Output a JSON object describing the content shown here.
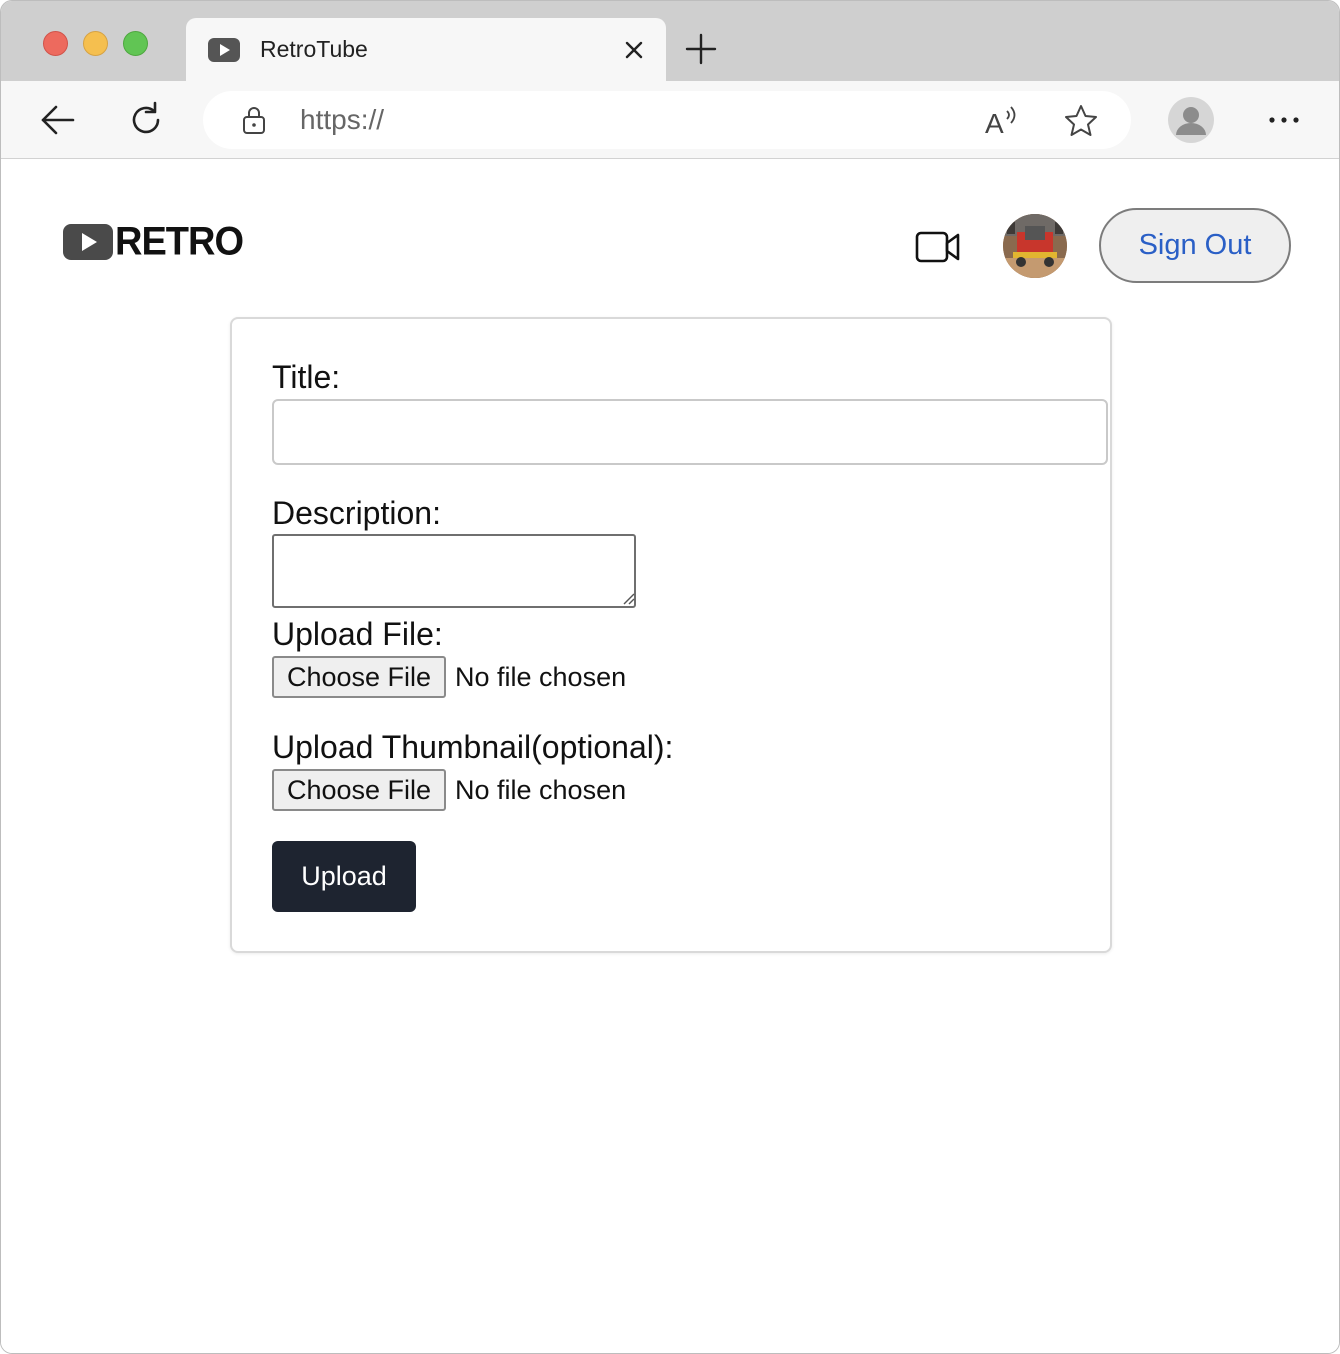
{
  "browser": {
    "tab": {
      "title": "RetroTube",
      "favicon": "play-icon"
    },
    "address_bar": {
      "url": "https://"
    },
    "icons": {
      "back": "arrow-left-icon",
      "reload": "reload-icon",
      "lock": "lock-icon",
      "read_aloud": "read-aloud-icon",
      "favorite": "star-icon",
      "profile": "profile-icon",
      "more": "more-icon",
      "close_tab": "close-icon",
      "new_tab": "plus-icon"
    }
  },
  "header": {
    "logo_text": "RETRO",
    "camera_icon": "video-camera-icon",
    "sign_out_label": "Sign Out"
  },
  "form": {
    "title_label": "Title:",
    "title_value": "",
    "description_label": "Description:",
    "description_value": "",
    "upload_file_label": "Upload File:",
    "upload_file_button": "Choose File",
    "upload_file_status": "No file chosen",
    "thumbnail_label": "Upload Thumbnail(optional):",
    "thumbnail_button": "Choose File",
    "thumbnail_status": "No file chosen",
    "submit_label": "Upload"
  },
  "colors": {
    "sign_out_text": "#2a5fc6",
    "upload_button_bg": "#1e2430",
    "tabstrip_bg": "#cfcfcf"
  }
}
